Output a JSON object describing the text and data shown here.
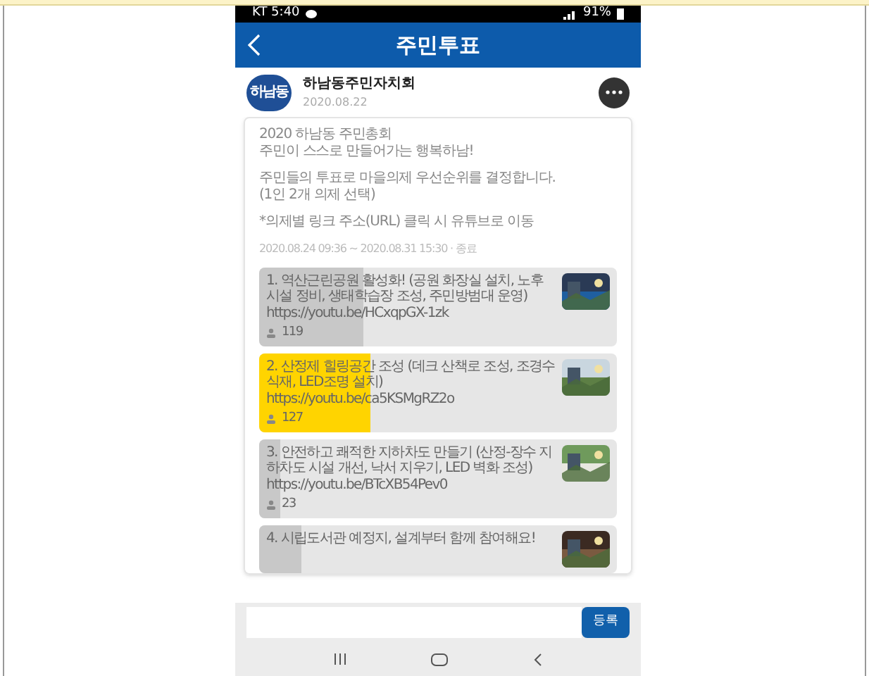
{
  "status_bar": {
    "carrier_time": "KT 5:40",
    "battery": "91%"
  },
  "header": {
    "title": "주민투표"
  },
  "post": {
    "author": "하남동주민자치회",
    "avatar_text": "하남동",
    "date": "2020.08.22"
  },
  "poll": {
    "intro": [
      "2020 하남동 주민총회",
      "주민이 스스로 만들어가는 행복하남!"
    ],
    "description": [
      "주민들의 투표로 마을의제 우선순위를 결정합니다.",
      "(1인 2개 의제 선택)"
    ],
    "note": "*의제별 링크 주소(URL) 클릭 시 유튜브로 이동",
    "period": "2020.08.24 09:36 ~ 2020.08.31 15:30 · 종료",
    "options": [
      {
        "title": "1. 역산근린공원 활성화! (공원 화장실 설치, 노후 시설 정비, 생태학습장 조성, 주민방범대 운영)",
        "link": "https://youtu.be/HCxqpGX-1zk",
        "votes": "119",
        "level": 0.29,
        "selected": false
      },
      {
        "title": "2. 산정제 힐링공간 조성 (데크 산책로 조성, 조경수 식재, LED조명 설치)",
        "link": "https://youtu.be/ca5KSMgRZ2o",
        "votes": "127",
        "level": 0.31,
        "selected": true
      },
      {
        "title": "3. 안전하고 쾌적한 지하차도 만들기 (산정-장수 지하차도 시설 개선, 낙서 지우기, LED 벽화 조성)",
        "link": "https://youtu.be/BTcXB54Pev0",
        "votes": "23",
        "level": 0.06,
        "selected": false
      },
      {
        "title": "4. 시립도서관 예정지, 설계부터 함께 참여해요!",
        "level": 0.12,
        "selected": false
      }
    ]
  },
  "comment_bar": {
    "submit": "등록"
  }
}
